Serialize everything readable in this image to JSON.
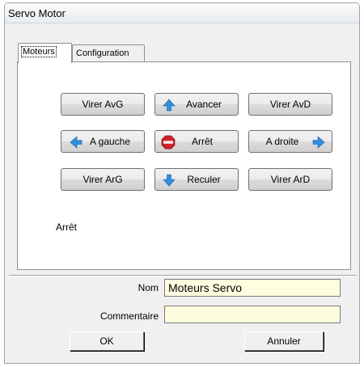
{
  "window": {
    "title": "Servo Motor"
  },
  "tabs": [
    {
      "label": "Moteurs",
      "active": true
    },
    {
      "label": "Configuration",
      "active": false
    }
  ],
  "controls": {
    "virer_avg": "Virer AvG",
    "avancer": "Avancer",
    "virer_avd": "Virer AvD",
    "a_gauche": "A gauche",
    "arret": "Arrêt",
    "a_droite": "A droite",
    "virer_arg": "Virer ArG",
    "reculer": "Reculer",
    "virer_ard": "Virer ArD"
  },
  "status_text": "Arrêt",
  "form": {
    "nom_label": "Nom",
    "nom_value": "Moteurs Servo",
    "commentaire_label": "Commentaire",
    "commentaire_value": ""
  },
  "footer": {
    "ok_label": "OK",
    "cancel_label": "Annuler"
  },
  "colors": {
    "field_bg": "#fffde0",
    "arrow_blue": "#2f8fde",
    "stop_red": "#d0202a"
  },
  "icons": {
    "up": "arrow-up-icon",
    "down": "arrow-down-icon",
    "left": "arrow-left-icon",
    "right": "arrow-right-icon",
    "stop": "stop-sign-icon"
  }
}
